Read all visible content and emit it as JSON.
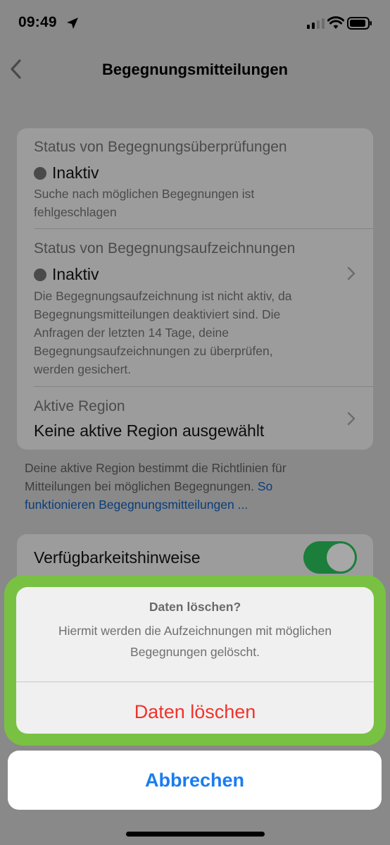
{
  "status_bar": {
    "time": "09:49",
    "icons": [
      "location-arrow-icon",
      "cellular-signal-icon",
      "wifi-icon",
      "battery-icon"
    ]
  },
  "nav": {
    "back_icon": "chevron-left-icon",
    "title": "Begegnungsmitteilungen"
  },
  "settings": {
    "check_status": {
      "label": "Status von Begegnungsüberprüfungen",
      "value": "Inaktiv",
      "description_lines": [
        "Suche nach möglichen Begegnungen ist",
        "fehlgeschlagen"
      ]
    },
    "record_status": {
      "label": "Status von Begegnungsaufzeichnungen",
      "value": "Inaktiv",
      "description_lines": [
        "Die Begegnungsaufzeichnung ist nicht aktiv, da",
        "Begegnungsmitteilungen deaktiviert sind. Die",
        "Anfragen der letzten 14 Tage, deine",
        "Begegnungsaufzeichnungen zu überprüfen,",
        "werden gesichert."
      ]
    },
    "region": {
      "label": "Aktive Region",
      "value": "Keine aktive Region ausgewählt"
    }
  },
  "footer": {
    "line1": "Deine aktive Region bestimmt die Richtlinien für",
    "line2_text": "Mitteilungen bei möglichen Begegnungen. ",
    "line2_link": "So",
    "line3_link": "funktionieren Begegnungsmitteilungen ..."
  },
  "availability": {
    "label": "Verfügbarkeitshinweise",
    "enabled": true
  },
  "action_sheet": {
    "title": "Daten löschen?",
    "message_lines": [
      "Hiermit werden die Aufzeichnungen mit möglichen",
      "Begegnungen gelöscht."
    ],
    "destructive_action": "Daten löschen",
    "cancel": "Abbrechen"
  },
  "colors": {
    "highlight_border": "#79c142",
    "destructive": "#f0332d",
    "cancel_text": "#1a7cf0",
    "toggle_on": "#1b7e3b"
  }
}
